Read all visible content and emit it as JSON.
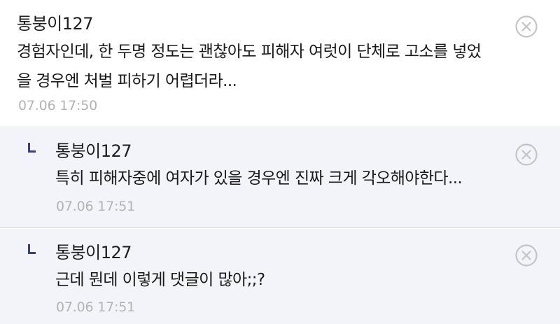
{
  "comments": [
    {
      "author": "통붕이127",
      "lines": [
        "경험자인데, 한 두명 정도는 괜찮아도 피해자 여럿이 단체로 고소를 넣었",
        "을 경우엔 처벌 피하기 어렵더라..."
      ],
      "time": "07.06 17:50",
      "is_reply": false
    },
    {
      "author": "통붕이127",
      "lines": [
        "특히 피해자중에 여자가 있을 경우엔 진짜 크게 각오해야한다..."
      ],
      "time": "07.06 17:51",
      "is_reply": true
    },
    {
      "author": "통붕이127",
      "lines": [
        "근데 뭔데 이렇게 댓글이 많아;;?"
      ],
      "time": "07.06 17:51",
      "is_reply": true
    }
  ],
  "icons": {
    "delete": "close-circle-icon",
    "reply": "reply-corner-icon"
  },
  "colors": {
    "reply_background": "#f3f4f9",
    "reply_marker": "#3b3f7a",
    "timestamp": "#b3b3b3",
    "divider": "#d9dbe6"
  }
}
